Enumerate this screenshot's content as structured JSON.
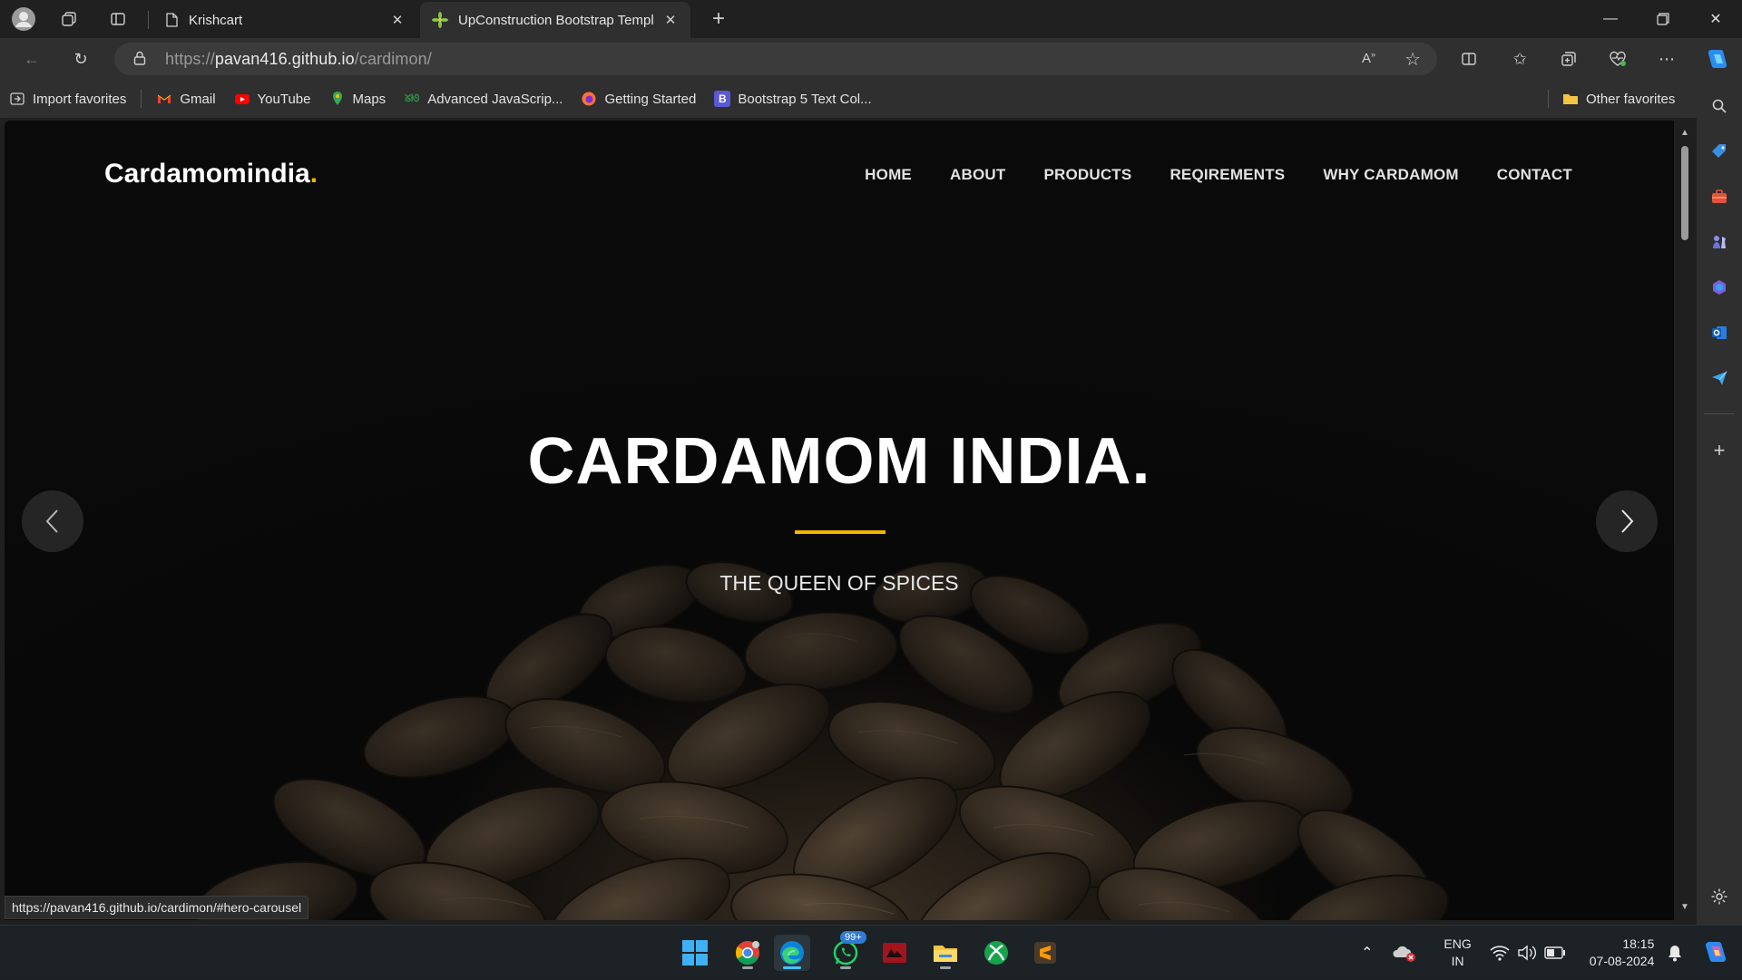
{
  "browser": {
    "tabs": [
      {
        "title": "Krishcart",
        "active": false
      },
      {
        "title": "UpConstruction Bootstrap Templ",
        "active": true
      }
    ],
    "address": {
      "scheme": "https://",
      "host": "pavan416.github.io",
      "path": "/cardimon/"
    },
    "favorites": [
      {
        "label": "Import favorites",
        "icon": "import-icon"
      },
      {
        "label": "Gmail",
        "icon": "gmail-icon"
      },
      {
        "label": "YouTube",
        "icon": "youtube-icon"
      },
      {
        "label": "Maps",
        "icon": "maps-icon"
      },
      {
        "label": "Advanced JavaScrip...",
        "icon": "geeksforgeeks-icon"
      },
      {
        "label": "Getting Started",
        "icon": "firefox-icon"
      },
      {
        "label": "Bootstrap 5 Text Col...",
        "icon": "bootstrap-icon"
      }
    ],
    "other_favorites": "Other favorites",
    "status_url": "https://pavan416.github.io/cardimon/#hero-carousel",
    "colors": {
      "frame": "#202020",
      "toolbar": "#2f2f2f",
      "omnibox": "#3b3b3b"
    }
  },
  "site": {
    "logo": "Cardamomindia",
    "logo_dot": ".",
    "nav": [
      "HOME",
      "ABOUT",
      "PRODUCTS",
      "REQIREMENTS",
      "WHY CARDAMOM",
      "CONTACT"
    ],
    "hero": {
      "title": "CARDAMOM INDIA.",
      "subtitle": "THE QUEEN OF SPICES"
    },
    "colors": {
      "accent": "#f5b301",
      "background": "#0a0a0a"
    }
  },
  "taskbar": {
    "apps": [
      "start-icon",
      "chrome-icon",
      "edge-icon",
      "whatsapp-icon",
      "app-icon",
      "file-explorer-icon",
      "xbox-icon",
      "sublime-text-icon"
    ],
    "whatsapp_badge": "99+",
    "language": {
      "line1": "ENG",
      "line2": "IN"
    },
    "time": "18:15",
    "date": "07-08-2024"
  }
}
